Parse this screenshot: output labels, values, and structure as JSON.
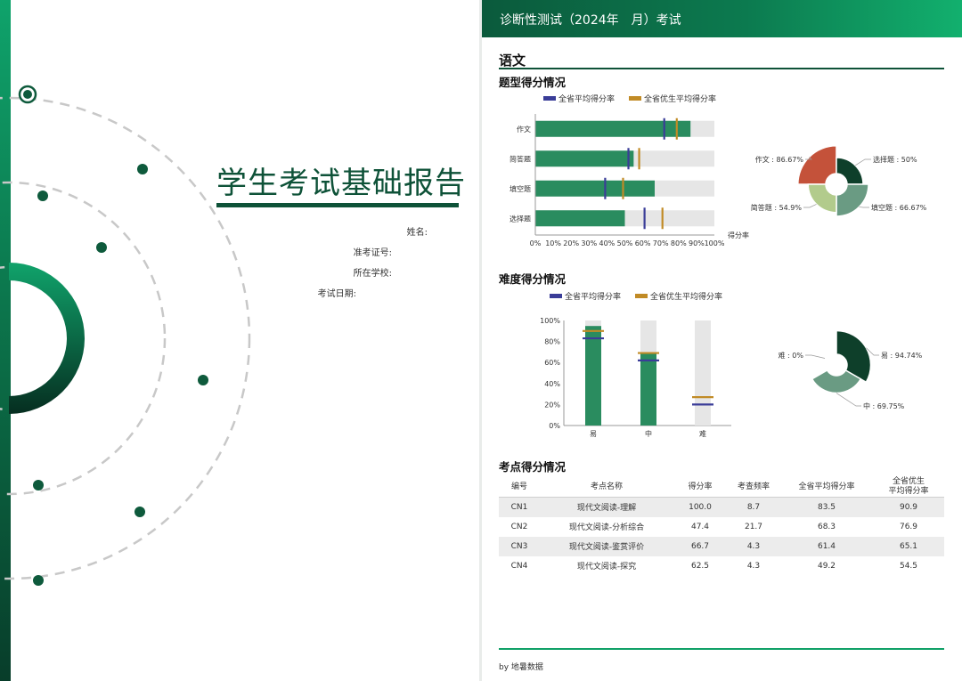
{
  "cover": {
    "title": "学生考试基础报告",
    "fields": [
      {
        "label": "姓名:"
      },
      {
        "label": "准考证号:"
      },
      {
        "label": "所在学校:"
      },
      {
        "label": "考试日期:"
      }
    ]
  },
  "report": {
    "header": "诊断性测试（2024年　月）考试",
    "subject": "语文",
    "sections": {
      "type_score": "题型得分情况",
      "difficulty_score": "难度得分情况",
      "knowledge_points": "考点得分情况"
    },
    "footer": "by 地暑数据"
  },
  "colors": {
    "bar_green": "#2a8c5f",
    "bar_track": "#e6e6e6",
    "avg_line": "#3a3d98",
    "excellent_line": "#c18b26"
  },
  "chart_data": [
    {
      "type": "bar",
      "orientation": "horizontal",
      "legend": [
        "全省平均得分率",
        "全省优生平均得分率"
      ],
      "categories": [
        "作文",
        "简答题",
        "填空题",
        "选择题"
      ],
      "series": [
        {
          "values": [
            86.67,
            54.9,
            66.67,
            50
          ]
        },
        {
          "name": "全省平均得分率",
          "values": [
            72,
            52,
            39,
            61
          ]
        },
        {
          "name": "全省优生平均得分率",
          "values": [
            79,
            58,
            49,
            71
          ]
        }
      ],
      "xlabel": "得分率",
      "xticks": [
        "0%",
        "10%",
        "20%",
        "30%",
        "40%",
        "50%",
        "60%",
        "70%",
        "80%",
        "90%",
        "100%"
      ],
      "xlim": [
        0,
        100
      ]
    },
    {
      "type": "pie",
      "variant": "rose",
      "slices": [
        {
          "label": "作文 : 86.67%",
          "value": 86.67,
          "color": "#c4523a"
        },
        {
          "label": "选择题 : 50%",
          "value": 50,
          "color": "#0e3f2a"
        },
        {
          "label": "填空题 : 66.67%",
          "value": 66.67,
          "color": "#6a9b83"
        },
        {
          "label": "简答题 : 54.9%",
          "value": 54.9,
          "color": "#b2cb8c"
        }
      ]
    },
    {
      "type": "bar",
      "orientation": "vertical",
      "legend": [
        "全省平均得分率",
        "全省优生平均得分率"
      ],
      "categories": [
        "易",
        "中",
        "难"
      ],
      "series": [
        {
          "values": [
            94.74,
            69.75,
            0
          ]
        },
        {
          "name": "全省平均得分率",
          "values": [
            83,
            62,
            20
          ]
        },
        {
          "name": "全省优生平均得分率",
          "values": [
            90,
            69,
            27
          ]
        }
      ],
      "yticks": [
        "0%",
        "20%",
        "40%",
        "60%",
        "80%",
        "100%"
      ],
      "ylim": [
        0,
        100
      ]
    },
    {
      "type": "pie",
      "variant": "rose",
      "slices": [
        {
          "label": "易 : 94.74%",
          "value": 94.74,
          "color": "#0e3f2a"
        },
        {
          "label": "中 : 69.75%",
          "value": 69.75,
          "color": "#6a9b83"
        },
        {
          "label": "难 : 0%",
          "value": 0,
          "color": "#b2cb8c"
        }
      ]
    }
  ],
  "table": {
    "headers": [
      "编号",
      "考点名称",
      "得分率",
      "考查频率",
      "全省平均得分率",
      "全省优生\n平均得分率"
    ],
    "rows": [
      [
        "CN1",
        "现代文阅读-理解",
        "100.0",
        "8.7",
        "83.5",
        "90.9"
      ],
      [
        "CN2",
        "现代文阅读-分析综合",
        "47.4",
        "21.7",
        "68.3",
        "76.9"
      ],
      [
        "CN3",
        "现代文阅读-鉴赏评价",
        "66.7",
        "4.3",
        "61.4",
        "65.1"
      ],
      [
        "CN4",
        "现代文阅读-探究",
        "62.5",
        "4.3",
        "49.2",
        "54.5"
      ]
    ]
  }
}
